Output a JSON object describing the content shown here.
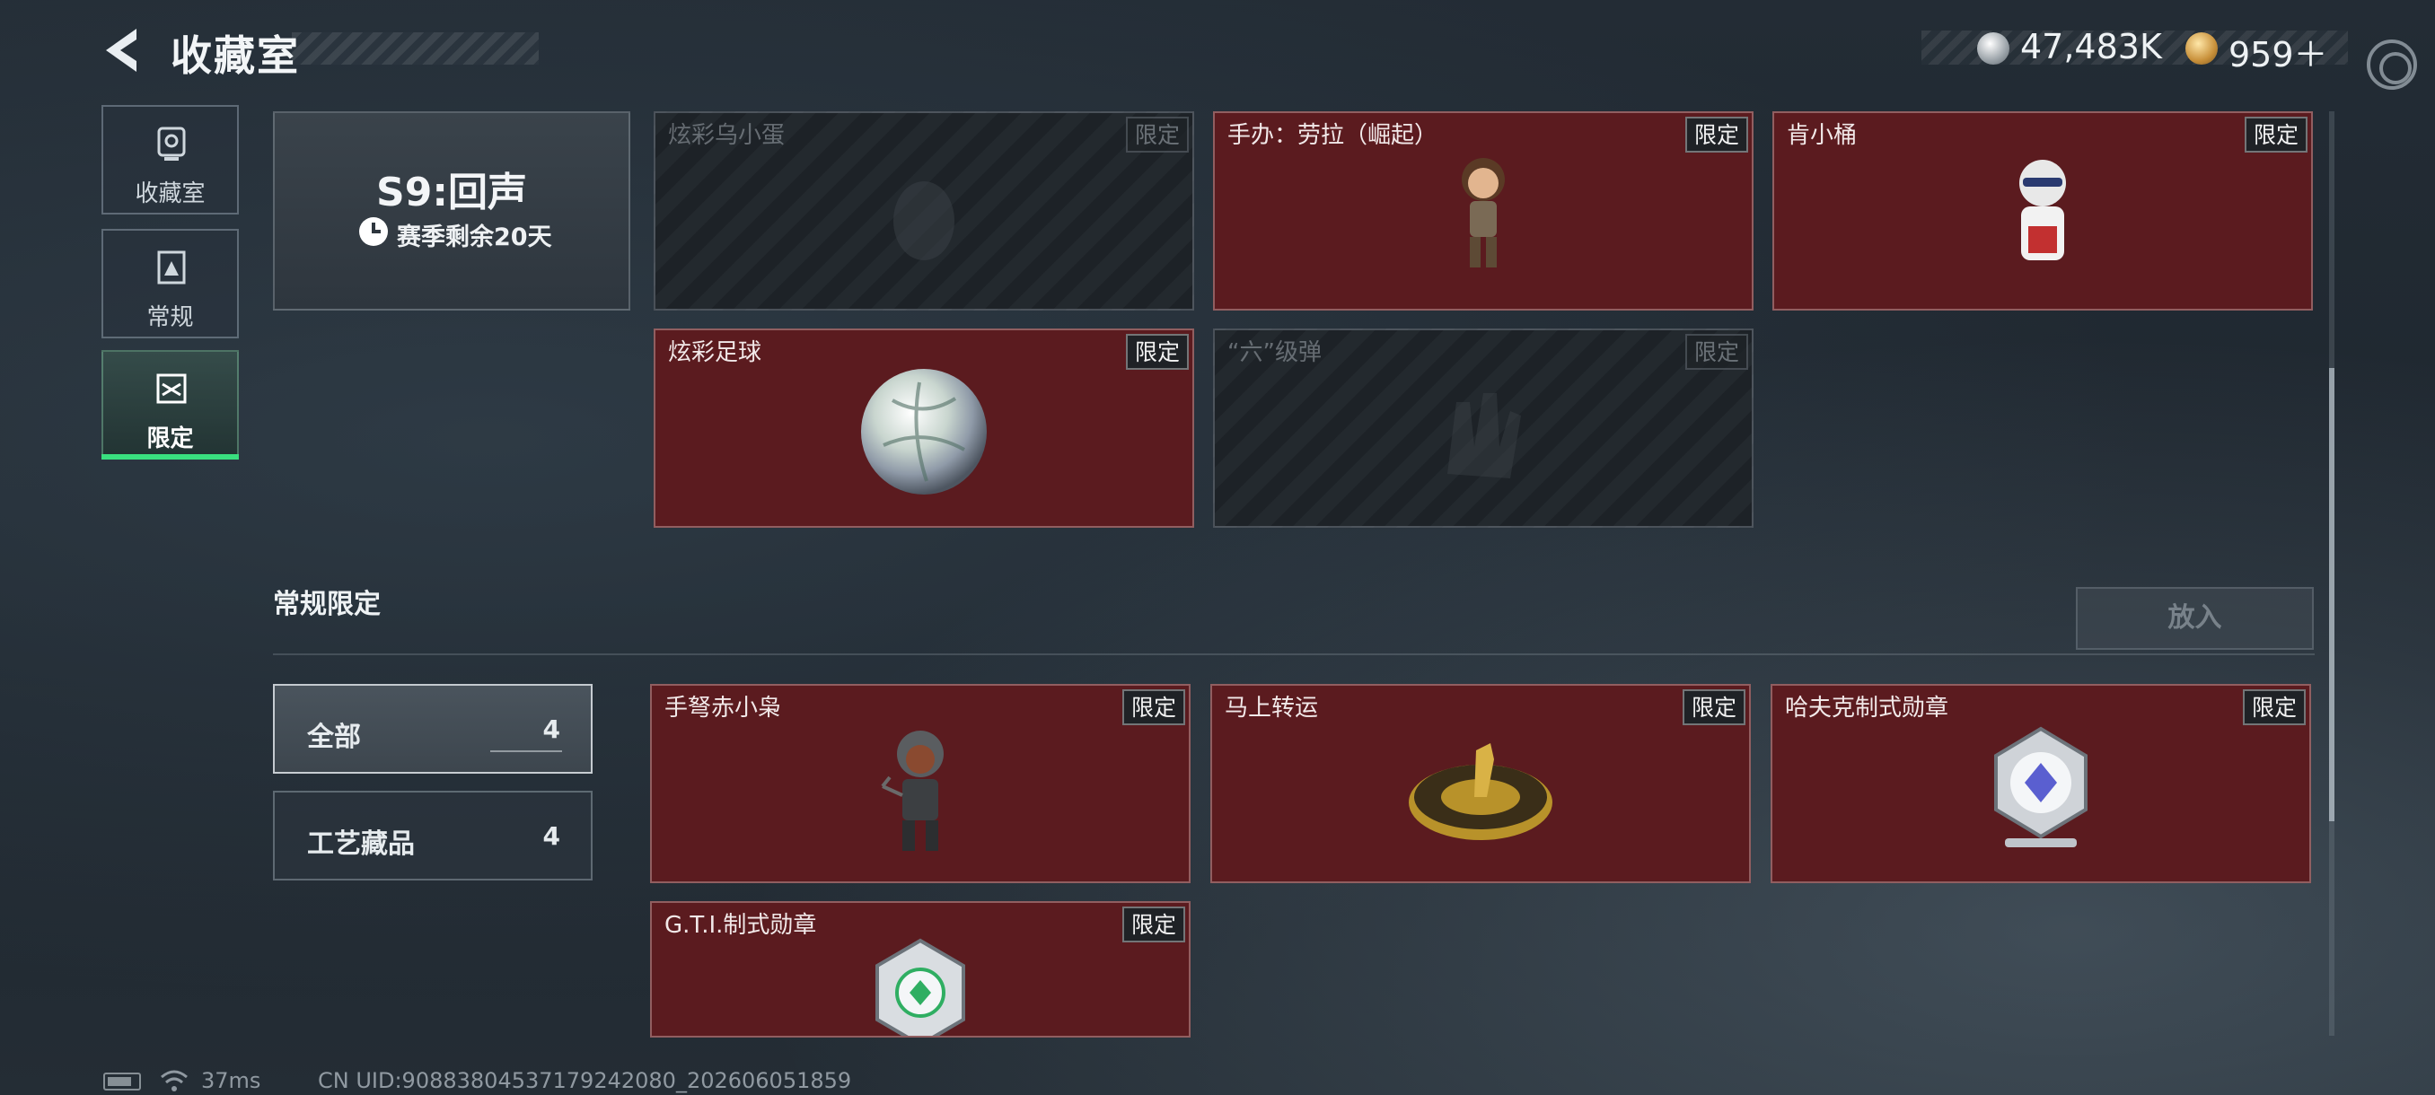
{
  "header": {
    "title": "收藏室",
    "currency_1": "47,483K",
    "currency_2": "959＋"
  },
  "nav": {
    "items": [
      {
        "label": "收藏室",
        "icon": "trophy-icon"
      },
      {
        "label": "常规",
        "icon": "frame-icon"
      },
      {
        "label": "限定",
        "icon": "limited-icon",
        "active": true
      }
    ]
  },
  "season": {
    "title": "S9:回声",
    "remaining": "赛季剩余20天"
  },
  "season_cards": [
    {
      "title": "炫彩乌小蛋",
      "badge": "限定",
      "locked": true
    },
    {
      "title": "手办：劳拉（崛起）",
      "badge": "限定",
      "locked": false
    },
    {
      "title": "肯小桶",
      "badge": "限定",
      "locked": false
    },
    {
      "title": "炫彩足球",
      "badge": "限定",
      "locked": false
    },
    {
      "title": "“六”级弹",
      "badge": "限定",
      "locked": true
    }
  ],
  "section": {
    "title": "常规限定",
    "place_button": "放入"
  },
  "filters": [
    {
      "label": "全部",
      "count": "4",
      "active": true
    },
    {
      "label": "工艺藏品",
      "count": "4",
      "active": false
    }
  ],
  "regular_cards": [
    {
      "title": "手弩赤小枭",
      "badge": "限定"
    },
    {
      "title": "马上转运",
      "badge": "限定"
    },
    {
      "title": "哈夫克制式勋章",
      "badge": "限定"
    },
    {
      "title": "G.T.I.制式勋章",
      "badge": "限定"
    }
  ],
  "footer": {
    "ping": "37ms",
    "uid": "CN UID:90883804537179242080_202606051859"
  },
  "colors": {
    "accent": "#39e07f",
    "card_bg": "#5b1b1f",
    "background": "#222a32"
  }
}
